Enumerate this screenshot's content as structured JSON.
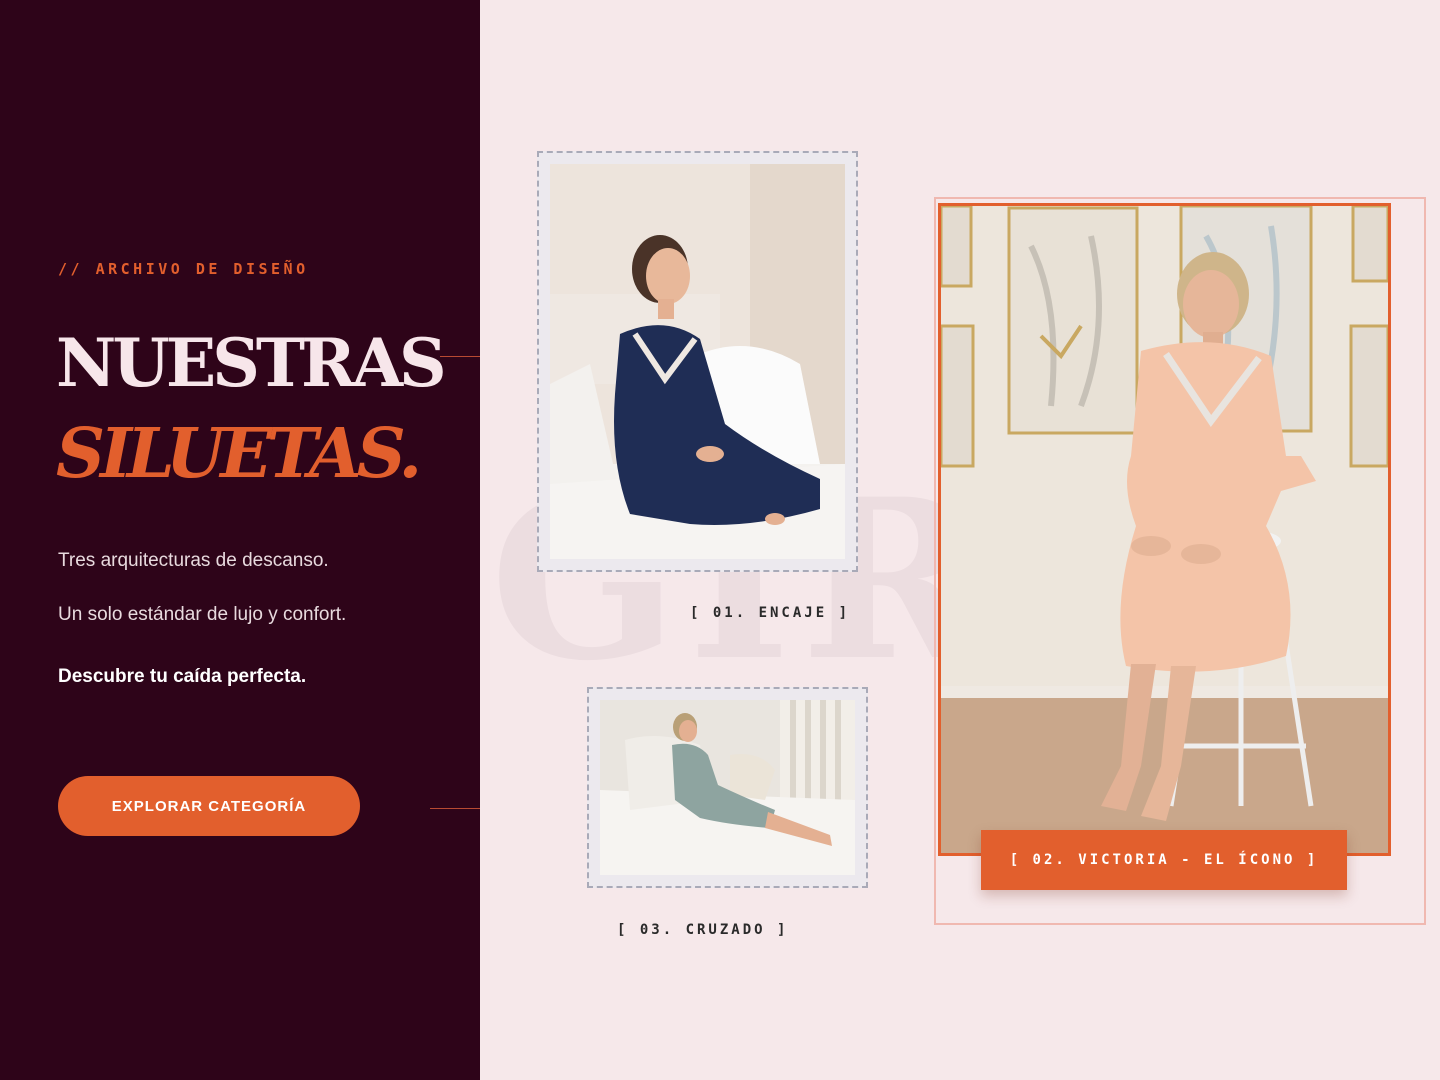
{
  "hero": {
    "eyebrow": "// ARCHIVO DE DISEÑO",
    "title_line1": "NUESTRAS",
    "title_line2": "SILUETAS.",
    "paragraph1": "Tres arquitecturas de descanso.",
    "paragraph2": "Un solo estándar de lujo y confort.",
    "paragraph3": "Descubre tu caída perfecta.",
    "cta_label": "EXPLORAR CATEGORÍA"
  },
  "gallery": {
    "items": [
      {
        "caption": "[ 01. ENCAJE ]"
      },
      {
        "caption": "[ 02. VICTORIA - EL ÍCONO ]"
      },
      {
        "caption": "[ 03. CRUZADO ]"
      }
    ]
  },
  "colors": {
    "left_panel": "#2e0419",
    "right_panel": "#f6e8ea",
    "accent": "#e25f2d",
    "title_light": "#f7e6ea"
  }
}
